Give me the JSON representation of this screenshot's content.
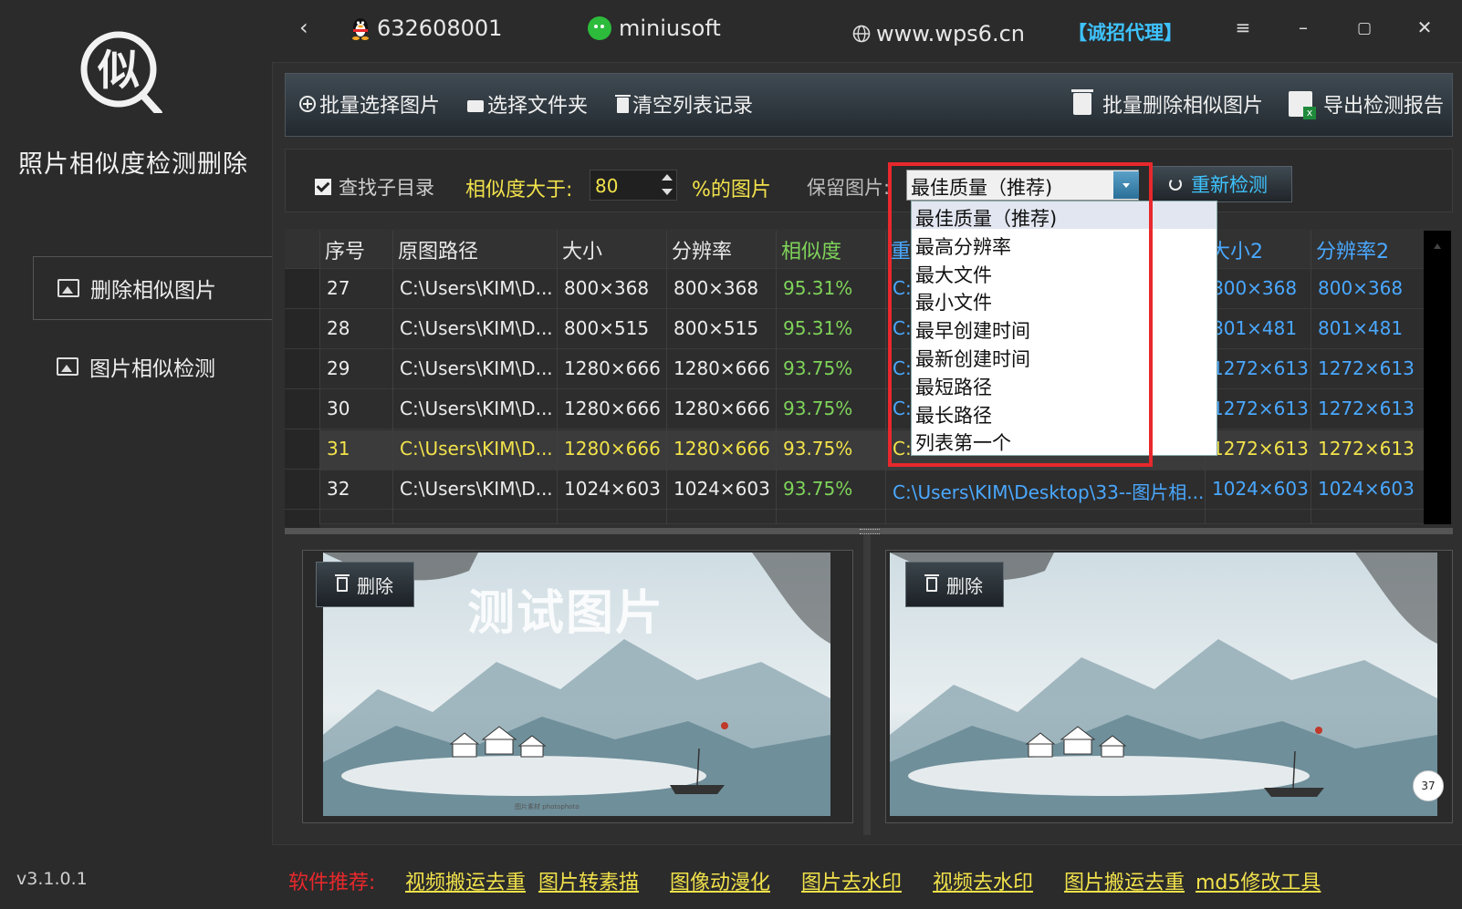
{
  "topbar": {
    "qq": "632608001",
    "wechat": "miniusoft",
    "site": "www.wps6.cn",
    "agent": "【诚招代理】"
  },
  "sidebar": {
    "logo_char": "似",
    "title": "照片相似度检测删除",
    "items": [
      {
        "label": "删除相似图片"
      },
      {
        "label": "图片相似检测"
      }
    ],
    "version": "v3.1.0.1"
  },
  "toolbar": {
    "batch_select": "批量选择图片",
    "select_folder": "选择文件夹",
    "clear_list": "清空列表记录",
    "batch_delete": "批量删除相似图片",
    "export_report": "导出检测报告"
  },
  "options": {
    "subdir_label": "查找子目录",
    "similarity_label": "相似度大于:",
    "similarity_value": "80",
    "percent_label": "%的图片",
    "keep_label": "保留图片:",
    "keep_value": "最佳质量（推荐)",
    "recheck_label": "重新检测"
  },
  "table": {
    "headers": [
      "序号",
      "原图路径",
      "大小",
      "分辨率",
      "相似度",
      "重",
      "大小2",
      "分辨率2"
    ],
    "rows": [
      {
        "no": "27",
        "path": "C:\\Users\\KIM\\D...",
        "size": "800×368",
        "res": "800×368",
        "sim": "95.31%",
        "path2": "C:",
        "size2": "800×368",
        "res2": "800×368"
      },
      {
        "no": "28",
        "path": "C:\\Users\\KIM\\D...",
        "size": "800×515",
        "res": "800×515",
        "sim": "95.31%",
        "path2": "C:",
        "size2": "801×481",
        "res2": "801×481"
      },
      {
        "no": "29",
        "path": "C:\\Users\\KIM\\D...",
        "size": "1280×666",
        "res": "1280×666",
        "sim": "93.75%",
        "path2": "C:",
        "size2": "1272×613",
        "res2": "1272×613"
      },
      {
        "no": "30",
        "path": "C:\\Users\\KIM\\D...",
        "size": "1280×666",
        "res": "1280×666",
        "sim": "93.75%",
        "path2": "C:",
        "size2": "1272×613",
        "res2": "1272×613"
      },
      {
        "no": "31",
        "path": "C:\\Users\\KIM\\D...",
        "size": "1280×666",
        "res": "1280×666",
        "sim": "93.75%",
        "path2": "C:",
        "size2": "1272×613",
        "res2": "1272×613"
      },
      {
        "no": "32",
        "path": "C:\\Users\\KIM\\D...",
        "size": "1024×603",
        "res": "1024×603",
        "sim": "93.75%",
        "path2": "C:\\Users\\KIM\\Desktop\\33--图片相...",
        "size2": "1024×603",
        "res2": "1024×603"
      }
    ]
  },
  "dropdown": {
    "options": [
      "最佳质量（推荐)",
      "最高分辨率",
      "最大文件",
      "最小文件",
      "最早创建时间",
      "最新创建时间",
      "最短路径",
      "最长路径",
      "列表第一个"
    ]
  },
  "preview": {
    "delete_label": "删除",
    "watermark": "测试图片",
    "badge": "37"
  },
  "footer": {
    "recommend_label": "软件推荐:",
    "links": [
      "视频搬运去重",
      "图片转素描",
      "图像动漫化",
      "图片去水印",
      "视频去水印",
      "图片搬运去重",
      "md5修改工具"
    ]
  },
  "colors": {
    "accent_yellow": "#f2e24b",
    "accent_blue": "#3ec3ff",
    "similarity_green": "#7fd35a",
    "highlight_red": "#e8282c"
  }
}
